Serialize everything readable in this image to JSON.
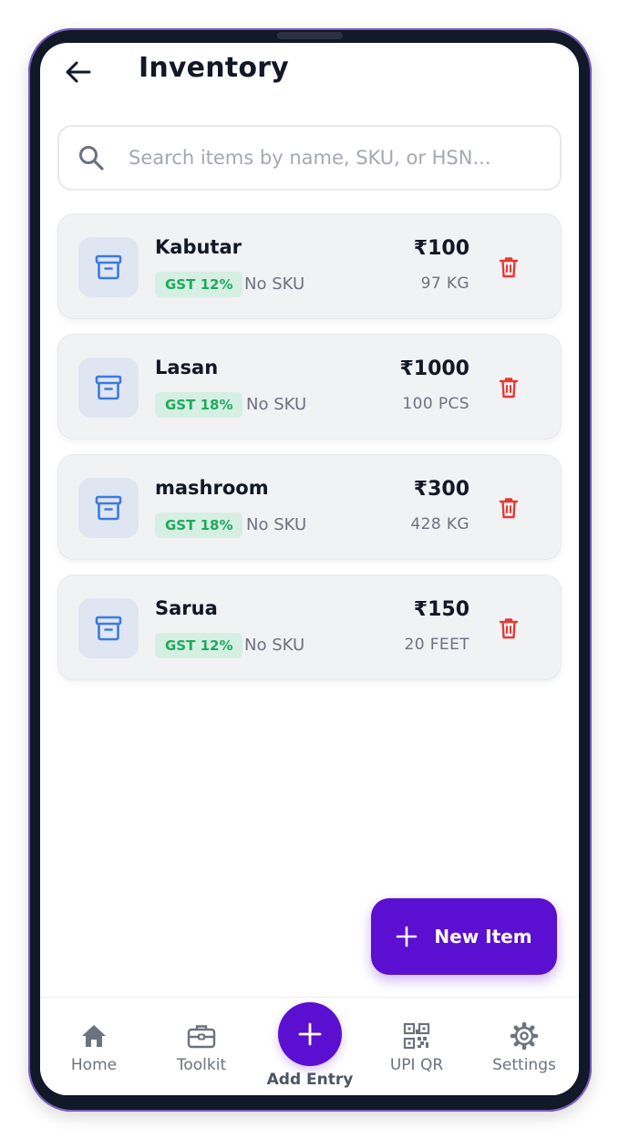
{
  "header": {
    "title": "Inventory"
  },
  "search": {
    "placeholder": "Search items by name, SKU, or HSN..."
  },
  "items": [
    {
      "name": "Kabutar",
      "gst": "GST 12%",
      "sku": "No SKU",
      "price": "₹100",
      "qty": "97 KG"
    },
    {
      "name": "Lasan",
      "gst": "GST 18%",
      "sku": "No SKU",
      "price": "₹1000",
      "qty": "100 PCS"
    },
    {
      "name": "mashroom",
      "gst": "GST 18%",
      "sku": "No SKU",
      "price": "₹300",
      "qty": "428 KG"
    },
    {
      "name": "Sarua",
      "gst": "GST 12%",
      "sku": "No SKU",
      "price": "₹150",
      "qty": "20 FEET"
    }
  ],
  "fab": {
    "label": "New Item"
  },
  "nav": {
    "home": "Home",
    "toolkit": "Toolkit",
    "add": "Add Entry",
    "upi": "UPI QR",
    "settings": "Settings"
  },
  "colors": {
    "accent": "#5b0fd0",
    "gst_badge_bg": "#d6efe3",
    "gst_badge_text": "#1faa5c",
    "delete": "#e53935",
    "item_icon": "#3b7be0"
  },
  "icons": {
    "back": "arrow-left-icon",
    "search": "search-icon",
    "item": "archive-box-icon",
    "delete": "trash-icon",
    "fab": "plus-icon",
    "home": "home-icon",
    "toolkit": "briefcase-icon",
    "add": "plus-icon",
    "upi": "qr-code-icon",
    "settings": "gear-icon"
  }
}
